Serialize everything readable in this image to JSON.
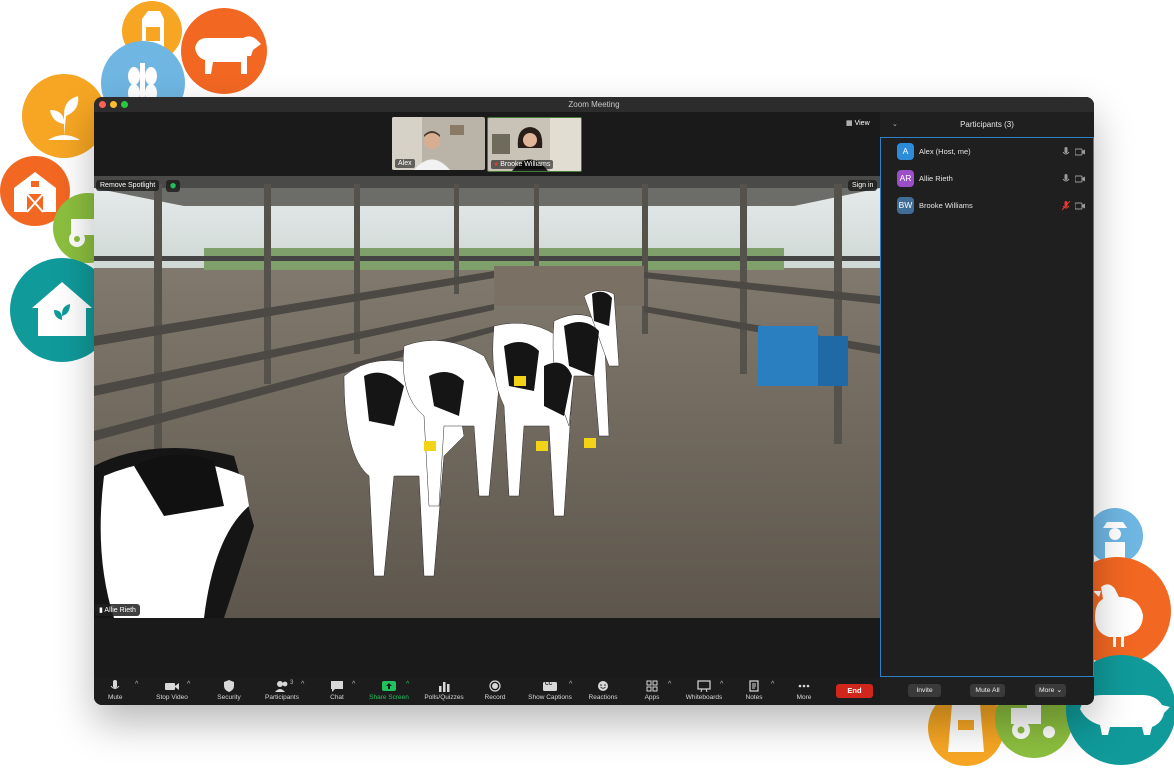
{
  "window": {
    "title": "Zoom Meeting"
  },
  "thumbnails": [
    {
      "name": "Alex"
    },
    {
      "name": "Brooke Williams"
    }
  ],
  "video": {
    "view_label": "View",
    "remove_spotlight_label": "Remove Spotlight",
    "sign_in_label": "Sign in",
    "speaker_name": "Allie Rieth"
  },
  "toolbar": {
    "mute": "Mute",
    "stop_video": "Stop Video",
    "security": "Security",
    "participants": "Participants",
    "participants_count": "3",
    "chat": "Chat",
    "share_screen": "Share Screen",
    "polls": "Polls/Quizzes",
    "record": "Record",
    "captions": "Show Captions",
    "captions_badge": "CC",
    "reactions": "Reactions",
    "apps": "Apps",
    "whiteboards": "Whiteboards",
    "notes": "Notes",
    "more": "More",
    "end": "End"
  },
  "panel": {
    "title": "Participants (3)",
    "participants": [
      {
        "initials": "A",
        "name": "Alex (Host, me)",
        "color": "#2d8cda",
        "muted": false
      },
      {
        "initials": "AR",
        "name": "Allie Rieth",
        "color": "#9b4ec8",
        "muted": false
      },
      {
        "initials": "BW",
        "name": "Brooke Williams",
        "color": "#3f6d95",
        "muted": true
      }
    ],
    "invite": "Invite",
    "mute_all": "Mute All",
    "more": "More"
  },
  "colors": {
    "accent": "#2f7fc7",
    "end_red": "#d0261c",
    "share_green": "#21c25e",
    "deco_orange": "#f26722",
    "deco_yellow": "#f6a623",
    "deco_blue": "#6fb6e3",
    "deco_green": "#8cbf3f",
    "deco_teal": "#109a9a"
  }
}
